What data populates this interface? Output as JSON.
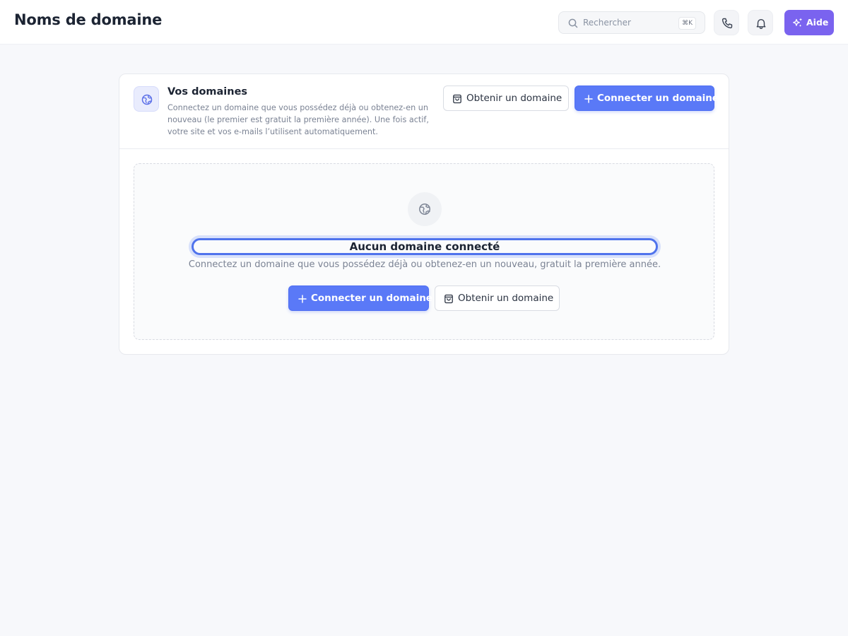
{
  "header": {
    "title": "Noms de domaine",
    "search": {
      "placeholder": "Rechercher",
      "shortcut": "⌘K"
    },
    "phone_icon": "phone-icon",
    "bell_icon": "bell-icon",
    "help_label": "Aide",
    "help_color": "#7a63ef"
  },
  "card": {
    "title": "Vos domaines",
    "description": "Connectez un domaine que vous possédez déjà ou obtenez-en un nouveau (le premier est gratuit la première année). Une fois actif, votre site et vos e-mails l’utilisent automatiquement.",
    "get_domain_label": "Obtenir un domaine",
    "connect_domain_label": "Connecter un domaine",
    "accent_color": "#5a79f7"
  },
  "empty_state": {
    "title": "Aucun domaine connecté",
    "description": "Connectez un domaine que vous possédez déjà ou obtenez-en un nouveau, gratuit la première année.",
    "connect_domain_label": "Connecter un domaine",
    "get_domain_label": "Obtenir un domaine"
  }
}
